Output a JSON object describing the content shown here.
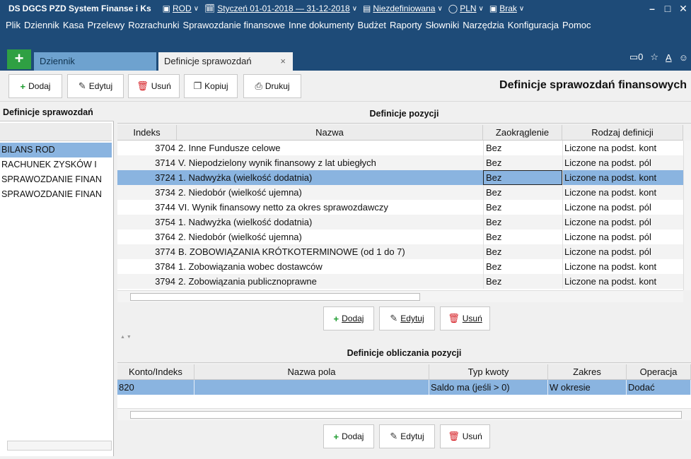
{
  "titlebar": {
    "logo": "DS",
    "app_title": "DGCS PZD System Finanse i Ks",
    "unit": "ROD",
    "period": "Styczeń 01-01-2018 — 31-12-2018",
    "filter": "Niezdefiniowana",
    "currency": "PLN",
    "extra": "Brak"
  },
  "menu": [
    "Plik",
    "Dziennik",
    "Kasa",
    "Przelewy",
    "Rozrachunki",
    "Sprawozdanie finansowe",
    "Inne dokumenty",
    "Budżet",
    "Raporty",
    "Słowniki",
    "Narzędzia",
    "Konfiguracja",
    "Pomoc"
  ],
  "tabs": {
    "plus": "+",
    "dziennik": "Dziennik",
    "definicje": "Definicje sprawozdań",
    "close": "×",
    "notif_count": "0",
    "right_label": "A"
  },
  "toolbar": {
    "dodaj": "Dodaj",
    "edytuj": "Edytuj",
    "usun": "Usuń",
    "kopiuj": "Kopiuj",
    "drukuj": "Drukuj",
    "heading": "Definicje sprawozdań finansowych"
  },
  "left": {
    "title": "Definicje sprawozdań",
    "items": [
      "BILANS ROD",
      "RACHUNEK ZYSKÓW I",
      "SPRAWOZDANIE FINAN",
      "SPRAWOZDANIE FINAN"
    ]
  },
  "positions": {
    "title": "Definicje pozycji",
    "headers": [
      "Indeks",
      "Nazwa",
      "Zaokrąglenie",
      "Rodzaj definicji"
    ],
    "rows": [
      [
        "3704",
        "2. Inne Fundusze celowe",
        "Bez",
        "Liczone na podst. kont"
      ],
      [
        "3714",
        "V. Niepodzielony wynik finansowy z lat ubiegłych",
        "Bez",
        "Liczone na podst. pól"
      ],
      [
        "3724",
        "1. Nadwyżka (wielkość dodatnia)",
        "Bez",
        "Liczone na podst. kont"
      ],
      [
        "3734",
        "2. Niedobór (wielkość ujemna)",
        "Bez",
        "Liczone na podst. kont"
      ],
      [
        "3744",
        "VI. Wynik finansowy netto za okres sprawozdawczy",
        "Bez",
        "Liczone na podst. pól"
      ],
      [
        "3754",
        "1. Nadwyżka (wielkość dodatnia)",
        "Bez",
        "Liczone na podst. pól"
      ],
      [
        "3764",
        "2. Niedobór (wielkość ujemna)",
        "Bez",
        "Liczone na podst. pól"
      ],
      [
        "3774",
        "B. ZOBOWIĄZANIA KRÓTKOTERMINOWE (od 1 do 7)",
        "Bez",
        "Liczone na podst. pól"
      ],
      [
        "3784",
        "1. Zobowiązania wobec dostawców",
        "Bez",
        "Liczone na podst. kont"
      ],
      [
        "3794",
        "2. Zobowiązania publicznoprawne",
        "Bez",
        "Liczone na podst. kont"
      ]
    ],
    "dodaj": "Dodaj",
    "edytuj": "Edytuj",
    "usun": "Usuń"
  },
  "calc": {
    "title": "Definicje obliczania pozycji",
    "headers": [
      "Konto/Indeks",
      "Nazwa pola",
      "Typ kwoty",
      "Zakres",
      "Operacja"
    ],
    "row": [
      "820",
      "",
      "Saldo ma (jeśli > 0)",
      "W okresie",
      "Dodać"
    ],
    "dodaj": "Dodaj",
    "edytuj": "Edytuj",
    "usun": "Usuń"
  },
  "colors": {
    "titlebar_bg": "#1e4b78",
    "selection": "#8ab4e0",
    "add_icon": "#1e9c2f",
    "delete_icon": "#d4181e"
  }
}
